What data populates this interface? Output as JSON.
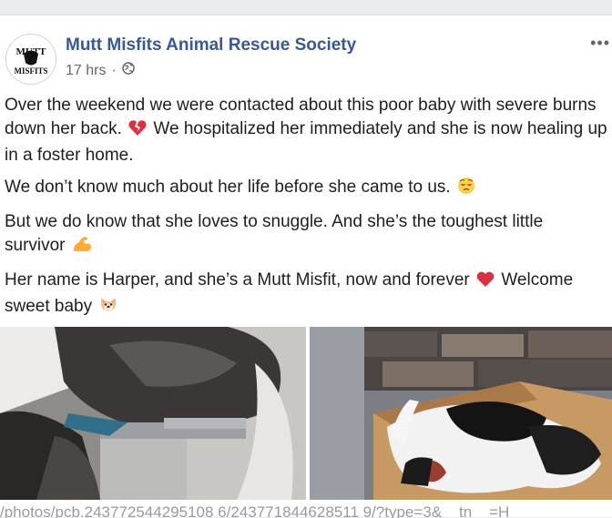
{
  "post": {
    "page_name": "Mutt Misfits Animal Rescue Society",
    "avatar_text_top": "MUTT",
    "avatar_text_bottom": "MISFITS",
    "timestamp": "17 hrs",
    "privacy_icon": "globe-icon",
    "more_icon": "ellipsis-icon",
    "more_label": "•••",
    "paragraphs": {
      "p1": "Over the weekend we were contacted about this poor baby with severe burns down her back.",
      "p1b": "We hospitalized her immediately and she is now healing up in a foster home.",
      "p2": "We don’t know much about her life before she came to us.",
      "p3": "But we do know that she loves to snuggle. And she’s the toughest little survivor",
      "p4": "Her name is Harper, and she’s a Mutt Misfit, now and forever",
      "p4b": "Welcome sweet baby"
    },
    "emojis": [
      "broken-heart-emoji",
      "pensive-face-emoji",
      "flexed-biceps-emoji",
      "red-heart-emoji",
      "dog-face-emoji"
    ],
    "photos": [
      "photo-dog-on-vet-table",
      "photo-dog-in-box"
    ]
  },
  "status_url": "/photos/pcb.243772544295108 6/243771844628511 9/?type=3&__tn__=H",
  "colors": {
    "link": "#385898",
    "text": "#1c1e21",
    "meta": "#616770",
    "background": "#e9ebee"
  }
}
